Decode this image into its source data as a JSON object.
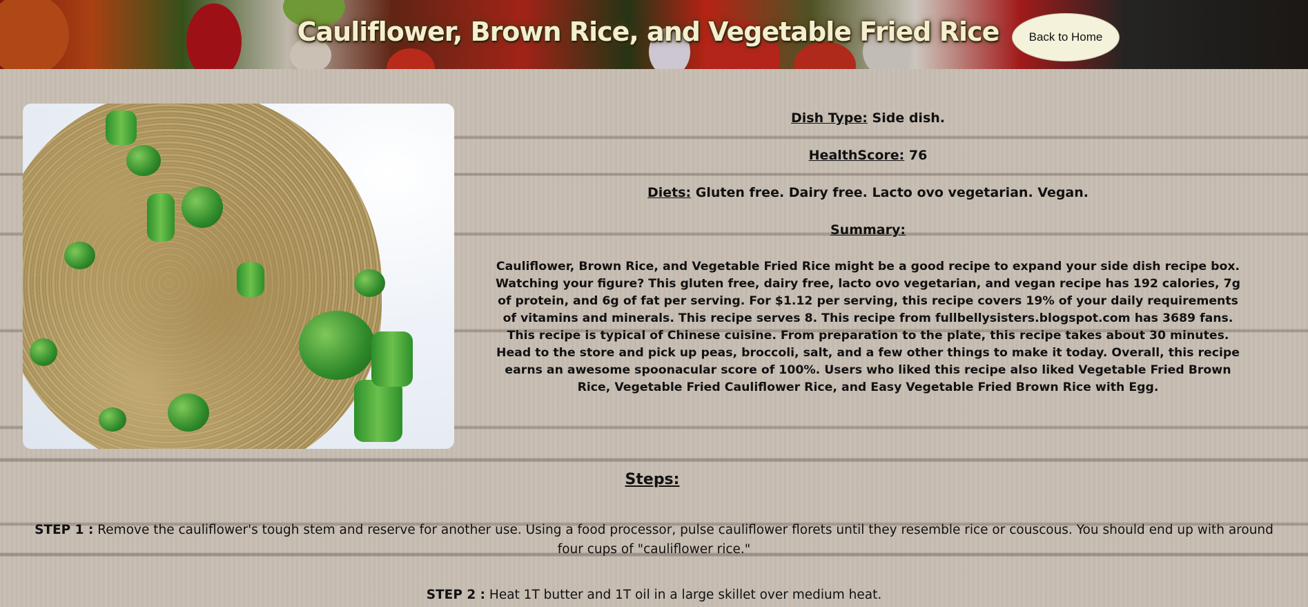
{
  "header": {
    "title": "Cauliflower, Brown Rice, and Vegetable Fried Rice",
    "back_button": "Back to Home"
  },
  "info": {
    "dish_type_label": "Dish Type:",
    "dish_type_value": "Side dish.",
    "health_score_label": "HealthScore:",
    "health_score_value": "76",
    "diets_label": "Diets:",
    "diets_value": "Gluten free. Dairy free. Lacto ovo vegetarian. Vegan.",
    "summary_label": "Summary:",
    "summary_text": "Cauliflower, Brown Rice, and Vegetable Fried Rice might be a good recipe to expand your side dish recipe box. Watching your figure? This gluten free, dairy free, lacto ovo vegetarian, and vegan recipe has 192 calories, 7g of protein, and 6g of fat per serving. For $1.12 per serving, this recipe covers 19% of your daily requirements of vitamins and minerals. This recipe serves 8. This recipe from fullbellysisters.blogspot.com has 3689 fans. This recipe is typical of Chinese cuisine. From preparation to the plate, this recipe takes about 30 minutes. Head to the store and pick up peas, broccoli, salt, and a few other things to make it today. Overall, this recipe earns an awesome spoonacular score of 100%. Users who liked this recipe also liked Vegetable Fried Brown Rice, Vegetable Fried Cauliflower Rice, and Easy Vegetable Fried Brown Rice with Egg."
  },
  "steps": {
    "title": "Steps:",
    "items": [
      {
        "label": "STEP 1 :",
        "text": "Remove the cauliflower's tough stem and reserve for another use. Using a food processor, pulse cauliflower florets until they resemble rice or couscous. You should end up with around four cups of \"cauliflower rice.\""
      },
      {
        "label": "STEP 2 :",
        "text": "Heat 1T butter and 1T oil in a large skillet over medium heat."
      }
    ]
  }
}
